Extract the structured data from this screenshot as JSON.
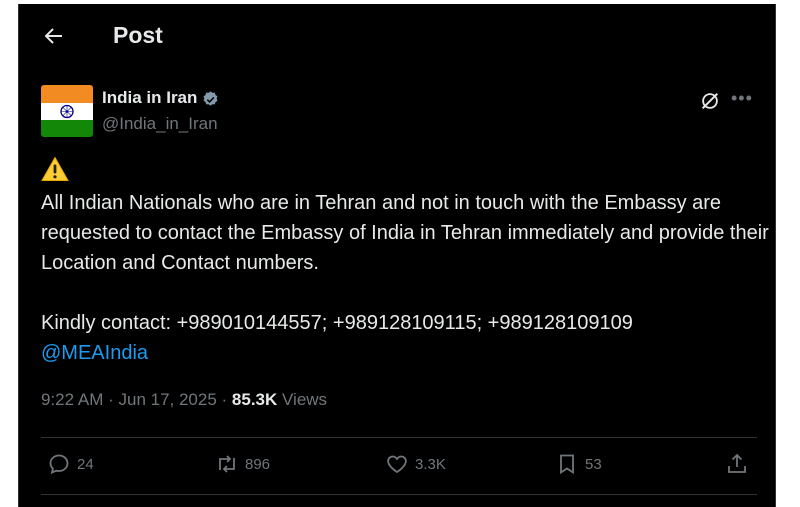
{
  "header": {
    "title": "Post",
    "back_icon": "arrow-left-icon"
  },
  "author": {
    "name": "India in Iran",
    "handle": "@India_in_Iran",
    "verified_color": "#829aab",
    "avatar": "india-flag"
  },
  "post": {
    "emoji": "warning-icon",
    "line1": "All Indian Nationals who are in Tehran and not in touch with the Embassy are requested to contact the Embassy of India in Tehran immediately and provide their Location and Contact numbers.",
    "line2": "Kindly contact: +989010144557; +989128109115; +989128109109",
    "mention": "@MEAIndia"
  },
  "meta": {
    "time": "9:22 AM",
    "sep1": " · ",
    "date": "Jun 17, 2025",
    "sep2": " · ",
    "views_count": "85.3K",
    "views_label": " Views"
  },
  "actions": {
    "replies": "24",
    "reposts": "896",
    "likes": "3.3K",
    "bookmarks": "53"
  },
  "colors": {
    "background": "#000000",
    "text": "#e7e9ea",
    "muted": "#71767b",
    "link": "#1d9bf0"
  }
}
